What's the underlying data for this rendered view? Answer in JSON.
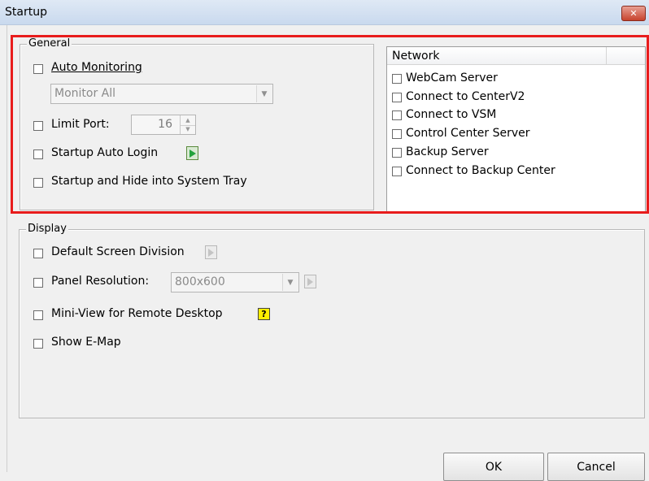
{
  "window": {
    "title": "Startup",
    "close_glyph": "✕"
  },
  "general": {
    "legend": "General",
    "auto_monitoring": {
      "label": "Auto Monitoring",
      "checked": false
    },
    "monitor_select": {
      "value": "Monitor All"
    },
    "limit_port": {
      "label": "Limit Port:",
      "value": "16",
      "checked": false
    },
    "startup_auto_login": {
      "label": "Startup Auto Login",
      "checked": false
    },
    "startup_hide_tray": {
      "label": "Startup and Hide into System Tray",
      "checked": false
    }
  },
  "network": {
    "header": "Network",
    "items": [
      {
        "label": "WebCam Server",
        "checked": false
      },
      {
        "label": "Connect to CenterV2",
        "checked": false
      },
      {
        "label": "Connect to VSM",
        "checked": false
      },
      {
        "label": "Control Center Server",
        "checked": false
      },
      {
        "label": "Backup Server",
        "checked": false
      },
      {
        "label": "Connect to Backup Center",
        "checked": false
      }
    ]
  },
  "display": {
    "legend": "Display",
    "default_screen_division": {
      "label": "Default Screen Division",
      "checked": false
    },
    "panel_resolution": {
      "label": "Panel Resolution:",
      "value": "800x600",
      "checked": false
    },
    "mini_view": {
      "label": "Mini-View for Remote Desktop",
      "checked": false
    },
    "show_emap": {
      "label": "Show E-Map",
      "checked": false
    },
    "help_glyph": "?"
  },
  "buttons": {
    "ok": "OK",
    "cancel": "Cancel"
  },
  "colors": {
    "highlight": "#e81c1c",
    "active_arrow": "#23a33c",
    "help_icon": "#ffee00"
  }
}
